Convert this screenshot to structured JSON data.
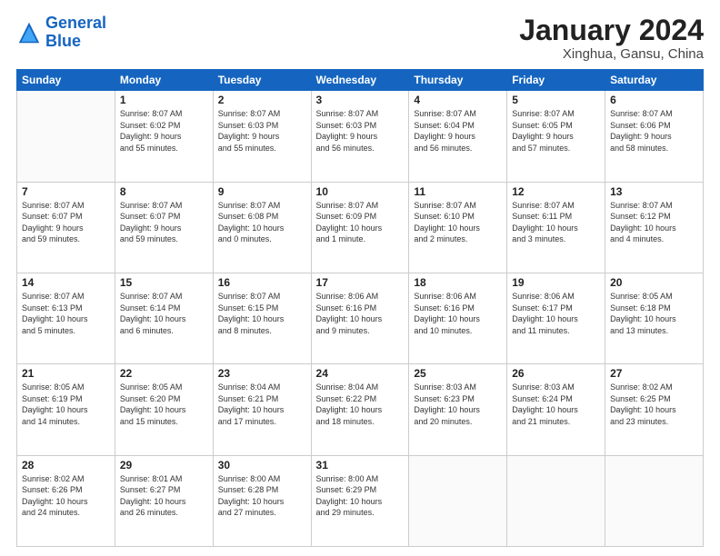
{
  "header": {
    "logo_line1": "General",
    "logo_line2": "Blue",
    "month": "January 2024",
    "location": "Xinghua, Gansu, China"
  },
  "columns": [
    "Sunday",
    "Monday",
    "Tuesday",
    "Wednesday",
    "Thursday",
    "Friday",
    "Saturday"
  ],
  "weeks": [
    [
      {
        "day": "",
        "info": ""
      },
      {
        "day": "1",
        "info": "Sunrise: 8:07 AM\nSunset: 6:02 PM\nDaylight: 9 hours\nand 55 minutes."
      },
      {
        "day": "2",
        "info": "Sunrise: 8:07 AM\nSunset: 6:03 PM\nDaylight: 9 hours\nand 55 minutes."
      },
      {
        "day": "3",
        "info": "Sunrise: 8:07 AM\nSunset: 6:03 PM\nDaylight: 9 hours\nand 56 minutes."
      },
      {
        "day": "4",
        "info": "Sunrise: 8:07 AM\nSunset: 6:04 PM\nDaylight: 9 hours\nand 56 minutes."
      },
      {
        "day": "5",
        "info": "Sunrise: 8:07 AM\nSunset: 6:05 PM\nDaylight: 9 hours\nand 57 minutes."
      },
      {
        "day": "6",
        "info": "Sunrise: 8:07 AM\nSunset: 6:06 PM\nDaylight: 9 hours\nand 58 minutes."
      }
    ],
    [
      {
        "day": "7",
        "info": "Sunrise: 8:07 AM\nSunset: 6:07 PM\nDaylight: 9 hours\nand 59 minutes."
      },
      {
        "day": "8",
        "info": "Sunrise: 8:07 AM\nSunset: 6:07 PM\nDaylight: 9 hours\nand 59 minutes."
      },
      {
        "day": "9",
        "info": "Sunrise: 8:07 AM\nSunset: 6:08 PM\nDaylight: 10 hours\nand 0 minutes."
      },
      {
        "day": "10",
        "info": "Sunrise: 8:07 AM\nSunset: 6:09 PM\nDaylight: 10 hours\nand 1 minute."
      },
      {
        "day": "11",
        "info": "Sunrise: 8:07 AM\nSunset: 6:10 PM\nDaylight: 10 hours\nand 2 minutes."
      },
      {
        "day": "12",
        "info": "Sunrise: 8:07 AM\nSunset: 6:11 PM\nDaylight: 10 hours\nand 3 minutes."
      },
      {
        "day": "13",
        "info": "Sunrise: 8:07 AM\nSunset: 6:12 PM\nDaylight: 10 hours\nand 4 minutes."
      }
    ],
    [
      {
        "day": "14",
        "info": "Sunrise: 8:07 AM\nSunset: 6:13 PM\nDaylight: 10 hours\nand 5 minutes."
      },
      {
        "day": "15",
        "info": "Sunrise: 8:07 AM\nSunset: 6:14 PM\nDaylight: 10 hours\nand 6 minutes."
      },
      {
        "day": "16",
        "info": "Sunrise: 8:07 AM\nSunset: 6:15 PM\nDaylight: 10 hours\nand 8 minutes."
      },
      {
        "day": "17",
        "info": "Sunrise: 8:06 AM\nSunset: 6:16 PM\nDaylight: 10 hours\nand 9 minutes."
      },
      {
        "day": "18",
        "info": "Sunrise: 8:06 AM\nSunset: 6:16 PM\nDaylight: 10 hours\nand 10 minutes."
      },
      {
        "day": "19",
        "info": "Sunrise: 8:06 AM\nSunset: 6:17 PM\nDaylight: 10 hours\nand 11 minutes."
      },
      {
        "day": "20",
        "info": "Sunrise: 8:05 AM\nSunset: 6:18 PM\nDaylight: 10 hours\nand 13 minutes."
      }
    ],
    [
      {
        "day": "21",
        "info": "Sunrise: 8:05 AM\nSunset: 6:19 PM\nDaylight: 10 hours\nand 14 minutes."
      },
      {
        "day": "22",
        "info": "Sunrise: 8:05 AM\nSunset: 6:20 PM\nDaylight: 10 hours\nand 15 minutes."
      },
      {
        "day": "23",
        "info": "Sunrise: 8:04 AM\nSunset: 6:21 PM\nDaylight: 10 hours\nand 17 minutes."
      },
      {
        "day": "24",
        "info": "Sunrise: 8:04 AM\nSunset: 6:22 PM\nDaylight: 10 hours\nand 18 minutes."
      },
      {
        "day": "25",
        "info": "Sunrise: 8:03 AM\nSunset: 6:23 PM\nDaylight: 10 hours\nand 20 minutes."
      },
      {
        "day": "26",
        "info": "Sunrise: 8:03 AM\nSunset: 6:24 PM\nDaylight: 10 hours\nand 21 minutes."
      },
      {
        "day": "27",
        "info": "Sunrise: 8:02 AM\nSunset: 6:25 PM\nDaylight: 10 hours\nand 23 minutes."
      }
    ],
    [
      {
        "day": "28",
        "info": "Sunrise: 8:02 AM\nSunset: 6:26 PM\nDaylight: 10 hours\nand 24 minutes."
      },
      {
        "day": "29",
        "info": "Sunrise: 8:01 AM\nSunset: 6:27 PM\nDaylight: 10 hours\nand 26 minutes."
      },
      {
        "day": "30",
        "info": "Sunrise: 8:00 AM\nSunset: 6:28 PM\nDaylight: 10 hours\nand 27 minutes."
      },
      {
        "day": "31",
        "info": "Sunrise: 8:00 AM\nSunset: 6:29 PM\nDaylight: 10 hours\nand 29 minutes."
      },
      {
        "day": "",
        "info": ""
      },
      {
        "day": "",
        "info": ""
      },
      {
        "day": "",
        "info": ""
      }
    ]
  ]
}
